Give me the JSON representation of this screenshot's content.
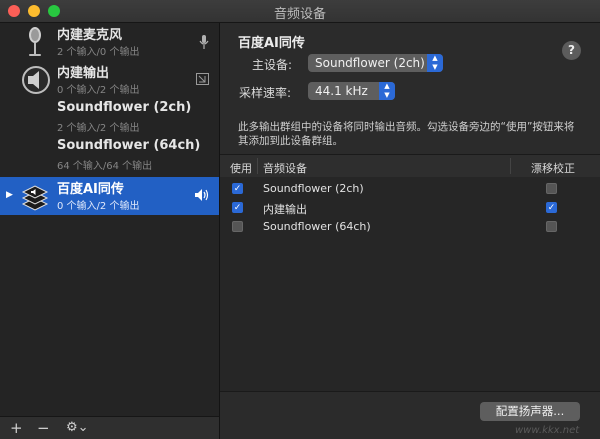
{
  "window": {
    "title": "音频设备"
  },
  "sidebar": {
    "devices": [
      {
        "name": "内建麦克风",
        "sub": "2 个输入/0 个输出"
      },
      {
        "name": "内建输出",
        "sub": "0 个输入/2 个输出"
      },
      {
        "name": "Soundflower (2ch)",
        "sub": "2 个输入/2 个输出"
      },
      {
        "name": "Soundflower (64ch)",
        "sub": "64 个输入/64 个输出"
      },
      {
        "name": "百度AI同传",
        "sub": "0 个输入/2 个输出"
      }
    ],
    "footer": {
      "add": "+",
      "remove": "−",
      "settings": "⚙⌄"
    }
  },
  "main": {
    "title": "百度AI同传",
    "help": "?",
    "master_label": "主设备:",
    "master_value": "Soundflower (2ch)",
    "rate_label": "采样速率:",
    "rate_value": "44.1 kHz",
    "description": "此多输出群组中的设备将同时输出音频。勾选设备旁边的“使用”按钮来将其添加到此设备群组。",
    "table": {
      "headers": {
        "use": "使用",
        "device": "音频设备",
        "drift": "漂移校正"
      },
      "rows": [
        {
          "name": "Soundflower (2ch)",
          "use": true,
          "drift": false
        },
        {
          "name": "内建输出",
          "use": true,
          "drift": true
        },
        {
          "name": "Soundflower (64ch)",
          "use": false,
          "drift": false
        }
      ]
    },
    "config_button": "配置扬声器...",
    "watermark": "www.kkx.net"
  },
  "colors": {
    "accent": "#2b69d6",
    "selection": "#2260c4"
  }
}
